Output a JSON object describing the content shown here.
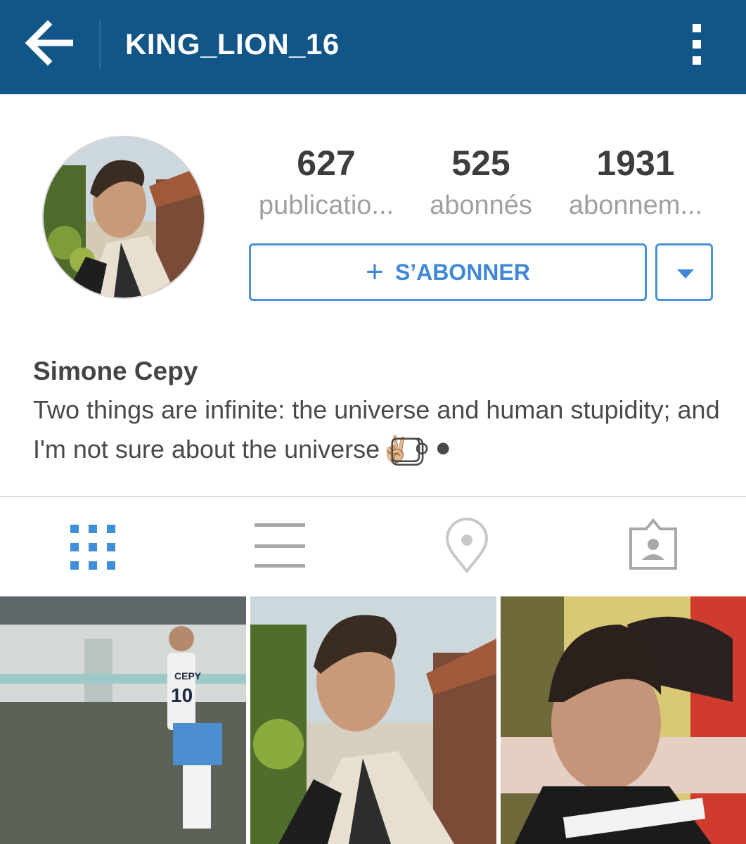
{
  "header": {
    "username": "KING_LION_16",
    "back_icon": "arrow-left-icon",
    "menu_icon": "vertical-dots-icon",
    "bg_color": "#125688"
  },
  "profile": {
    "stats": [
      {
        "count": "627",
        "label": "publicatio..."
      },
      {
        "count": "525",
        "label": "abonnés"
      },
      {
        "count": "1931",
        "label": "abonnem..."
      }
    ],
    "follow_label": "S’ABONNER",
    "follow_icon": "plus-icon",
    "dropdown_icon": "caret-down-icon",
    "accent_color": "#4a90d9",
    "full_name": "Simone Cepy",
    "bio": "Two things are infinite: the universe and human stupidity; and I'm not sure about the universe✌🏼⃣⃣⚪⚫"
  },
  "tabs": [
    {
      "icon": "grid-view-icon",
      "active": true
    },
    {
      "icon": "list-view-icon",
      "active": false
    },
    {
      "icon": "location-pin-icon",
      "active": false
    },
    {
      "icon": "tagged-photos-icon",
      "active": false
    }
  ],
  "grid": {
    "photos": [
      {
        "subject": "player in jersey on field",
        "jersey_text": "CEPY",
        "jersey_number": "10"
      },
      {
        "subject": "selfie outdoors"
      },
      {
        "subject": "selfie close-up"
      }
    ]
  }
}
